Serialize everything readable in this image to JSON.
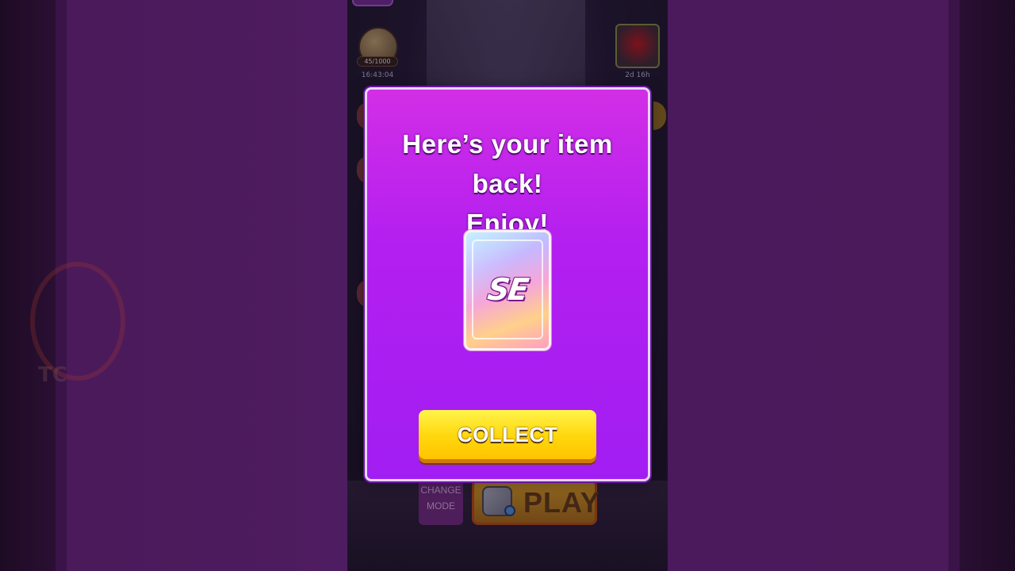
{
  "modal": {
    "title_line1": "Here’s your item back!",
    "title_line2": "Enjoy!",
    "item_label": "SE",
    "collect_label": "COLLECT"
  },
  "background": {
    "event_progress": "45/1000",
    "event_timer": "16:43:04",
    "hero_timer": "2d 16h",
    "change_mode_label_line1": "CHANGE",
    "change_mode_label_line2": "MODE",
    "play_label": "PLAY",
    "side_ghost_text": "TC"
  },
  "colors": {
    "modal_top": "#d22ee6",
    "modal_bottom": "#a11ef2",
    "collect_button": "#ffd60c"
  }
}
